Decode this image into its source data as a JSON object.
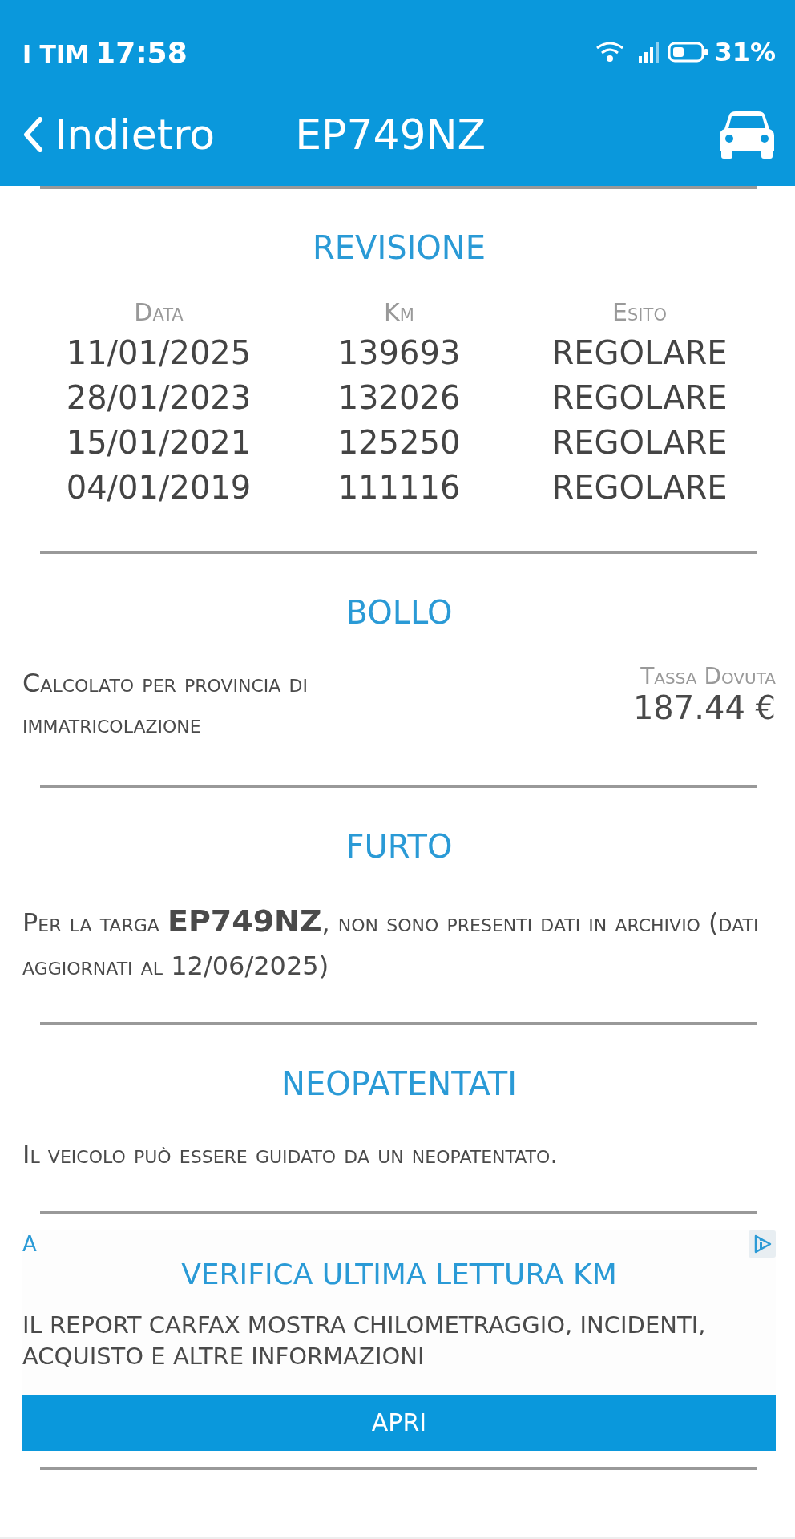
{
  "status_bar": {
    "carrier": "I TIM",
    "time": "17:58",
    "battery_percent": "31%"
  },
  "nav": {
    "back": "Indietro",
    "title": "EP749NZ"
  },
  "revisione": {
    "title": "REVISIONE",
    "columns": [
      "Data",
      "Km",
      "Esito"
    ],
    "rows": [
      [
        "11/01/2025",
        "139693",
        "REGOLARE"
      ],
      [
        "28/01/2023",
        "132026",
        "REGOLARE"
      ],
      [
        "15/01/2021",
        "125250",
        "REGOLARE"
      ],
      [
        "04/01/2019",
        "111116",
        "REGOLARE"
      ]
    ]
  },
  "bollo": {
    "title": "BOLLO",
    "description": "Calcolato per provincia di immatricolazione",
    "tax_label": "Tassa Dovuta",
    "tax_value": "187.44 €"
  },
  "furto": {
    "title": "FURTO",
    "text": "Per la targa **EP749NZ**, non sono presenti dati in archivio (dati aggiornati al 12/06/2025)"
  },
  "neopatentati": {
    "title": "NEOPATENTATI",
    "text": "Il veicolo può essere guidato da un neopatentato."
  },
  "ad": {
    "badge": "A",
    "title": "VERIFICA ULTIMA LETTURA KM",
    "text": "IL REPORT CARFAX MOSTRA CHILOMETRAGGIO, INCIDENTI, ACQUISTO E ALTRE INFORMAZIONI",
    "button": "APRI"
  }
}
